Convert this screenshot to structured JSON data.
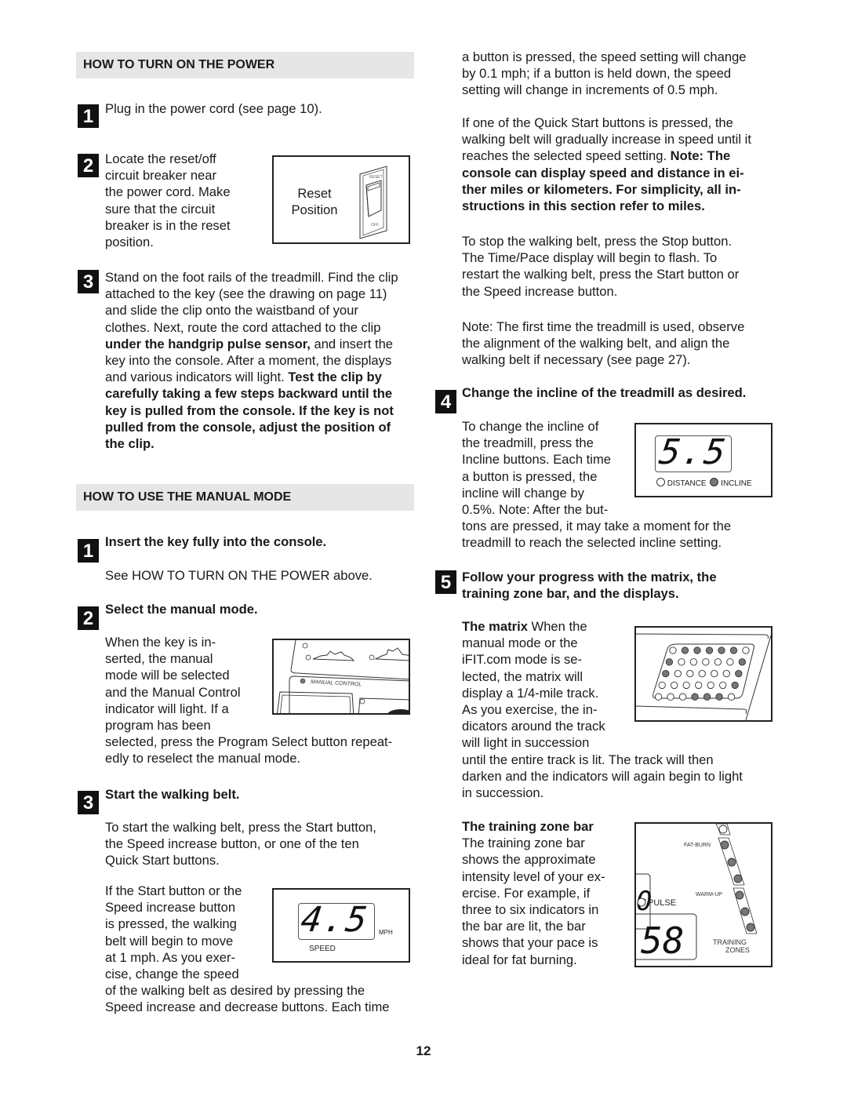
{
  "page_number": "12",
  "power_section": {
    "header": "HOW TO TURN ON THE POWER",
    "steps": [
      {
        "number": "1",
        "text": "Plug in the power cord (see page 10)."
      },
      {
        "number": "2",
        "lines": [
          "Locate the reset/off",
          "circuit breaker near",
          "the power cord. Make",
          "sure that the circuit",
          "breaker is in the reset",
          "position."
        ]
      },
      {
        "number": "3",
        "lines": [
          {
            "plain": "Stand on the foot rails of the treadmill. Find the clip"
          },
          {
            "plain": "attached to the key (see the drawing on page 11)"
          },
          {
            "plain": "and slide the clip onto the waistband of your"
          },
          {
            "plain": "clothes. Next, route the cord attached to the clip"
          },
          {
            "bold": "under the handgrip pulse sensor,",
            "plain": " and insert the"
          },
          {
            "plain": "key into the console. After a moment, the displays"
          },
          {
            "plain": "and various indicators will light. ",
            "bold": "Test the clip by"
          },
          {
            "bold": "carefully taking a few steps backward until the"
          },
          {
            "bold": "key is pulled from the console. If the key is not"
          },
          {
            "bold": "pulled from the console, adjust the position of"
          },
          {
            "bold": "the clip."
          }
        ]
      }
    ],
    "breaker_figure": {
      "label_line1": "Reset",
      "label_line2": "Position",
      "switch_top": "RESET",
      "switch_bottom": "OFF"
    }
  },
  "manual_section": {
    "header": "HOW TO USE THE MANUAL MODE",
    "step1": {
      "number": "1",
      "title": "Insert the key fully into the console.",
      "text": "See HOW TO TURN ON THE POWER above."
    },
    "step2": {
      "number": "2",
      "title": "Select the manual mode.",
      "lines": [
        "When the key is in-",
        "serted, the manual",
        "mode will be selected",
        "and the Manual Control",
        "indicator will light. If a",
        "program has been",
        "selected, press the Program Select button repeat-",
        "edly to reselect the manual mode."
      ],
      "figure_label": "MANUAL CONTROL"
    },
    "step3": {
      "number": "3",
      "title": "Start the walking belt.",
      "para1": [
        "To start the walking belt, press the Start button,",
        "the Speed increase button, or one of the ten",
        "Quick Start buttons."
      ],
      "para2": [
        "If the Start button or the",
        "Speed increase button",
        "is pressed, the walking",
        "belt will begin to move",
        "at 1 mph. As you exer-",
        "cise, change the speed",
        "of the walking belt as desired by pressing the",
        "Speed increase and decrease buttons. Each time"
      ],
      "speed_display": {
        "value": "4.5",
        "unit": "MPH",
        "label": "SPEED"
      }
    }
  },
  "right_column": {
    "para_speed": [
      "a button is pressed, the speed setting will change",
      "by 0.1 mph; if a button is held down, the speed",
      "setting will change in increments of 0.5 mph."
    ],
    "para_quick": {
      "lines_plain": [
        "If one of the Quick Start buttons is pressed, the",
        "walking belt will gradually increase in speed until it"
      ],
      "line3_plain": "reaches the selected speed setting. ",
      "line3_bold": "Note: The",
      "lines_bold": [
        "console can display speed and distance in ei-",
        "ther miles or kilometers. For simplicity, all in-",
        "structions in this section refer to miles."
      ]
    },
    "para_stop": [
      "To stop the walking belt, press the Stop button.",
      "The Time/Pace display will begin to flash. To",
      "restart the walking belt, press the Start button or",
      "the Speed increase button."
    ],
    "para_note": [
      "Note: The first time the treadmill is used, observe",
      "the alignment of the walking belt, and align the",
      "walking belt if necessary (see page 27)."
    ],
    "step4": {
      "number": "4",
      "title": "Change the incline of the treadmill as desired.",
      "lines": [
        "To change the incline of",
        "the treadmill, press the",
        "Incline buttons. Each time",
        "a button is pressed, the",
        "incline will change by",
        "0.5%. Note: After the but-",
        "tons are pressed, it may take a moment for the",
        "treadmill to reach the selected incline setting."
      ],
      "incline_display": {
        "value": "5.5",
        "label_distance": "DISTANCE",
        "label_incline": "INCLINE",
        "active": "incline"
      }
    },
    "step5": {
      "number": "5",
      "title_line1": "Follow your progress with the matrix, the",
      "title_line2": "training zone bar, and the displays.",
      "matrix": {
        "title": "The matrix",
        "first_line_rest": " When the",
        "lines": [
          "manual mode or the",
          "iFIT.com mode is se-",
          "lected, the matrix will",
          "display a 1/4-mile track.",
          "As you exercise, the in-",
          "dicators around the track",
          "will light in succession",
          "until the entire track is lit. The track will then",
          "darken and the indicators will again begin to light",
          "in succession."
        ],
        "pattern": [
          [
            0,
            1,
            1,
            1,
            1,
            1,
            0
          ],
          [
            1,
            0,
            0,
            0,
            0,
            0,
            1
          ],
          [
            1,
            0,
            0,
            0,
            0,
            0,
            1
          ],
          [
            0,
            0,
            0,
            0,
            0,
            0,
            1
          ],
          [
            0,
            0,
            0,
            1,
            1,
            1,
            0
          ]
        ]
      },
      "zone_bar": {
        "title": "The training zone bar",
        "lines": [
          "The training zone bar",
          "shows the approximate",
          "intensity level of your ex-",
          "ercise. For example, if",
          "three to six indicators in",
          "the bar are lit, the bar",
          "shows that your pace is",
          "ideal for fat burning."
        ],
        "label_fatburn": "FAT-BURN",
        "label_warmup": "WARM-UP",
        "label_pulse": "PULSE",
        "label_zones_1": "TRAINING",
        "label_zones_2": "ZONES",
        "pulse_value": "58",
        "lit_indicators": 6
      }
    }
  },
  "colors": {
    "header_bg": "#e6e6e6",
    "number_bg": "#111111",
    "lit_indicator": "#777777",
    "text": "#1a1a1a"
  }
}
